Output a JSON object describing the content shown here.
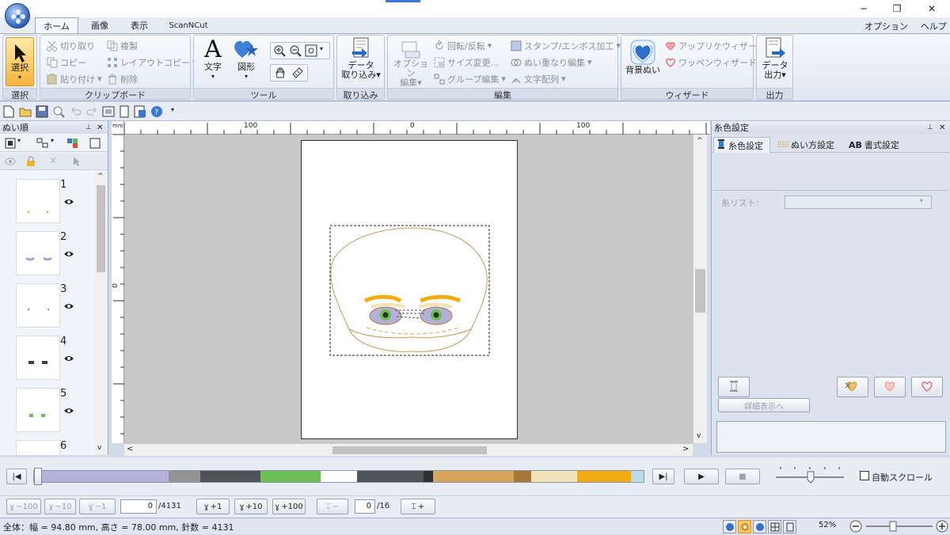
{
  "window": {
    "minimize": "─",
    "maximize": "❐",
    "close": "✕"
  },
  "tabs": [
    "ホーム",
    "画像",
    "表示",
    "ScanNCut"
  ],
  "menu_right": {
    "options": "オプション",
    "help": "ヘルプ"
  },
  "ribbon": {
    "select": {
      "label": "選択",
      "group": "選択"
    },
    "clipboard": {
      "group": "クリップボード",
      "cut": "切り取り",
      "copy": "コピー",
      "paste": "貼り付け",
      "duplicate": "複製",
      "layout_copy": "レイアウトコピー",
      "delete": "削除"
    },
    "tools": {
      "group": "ツール",
      "text": "文字",
      "shape": "図形"
    },
    "import": {
      "group": "取り込み",
      "label_line1": "データ",
      "label_line2": "取り込み"
    },
    "edit": {
      "group": "編集",
      "option_edit_1": "オプション",
      "option_edit_2": "編集",
      "rotate": "回転/反転",
      "resize": "サイズ変更...",
      "group_edit": "グループ編集",
      "stamp": "スタンプ/エンボス加工",
      "overlap": "ぬい重なり編集",
      "text_arrange": "文字配列"
    },
    "wizard": {
      "group": "ウィザード",
      "bg_stitch": "背景ぬい",
      "applique": "アップリケウィザード",
      "patch": "ワッペンウィザード"
    },
    "output": {
      "group": "出力",
      "label_line1": "データ",
      "label_line2": "出力"
    }
  },
  "left_panel": {
    "title": "ぬい順",
    "items": [
      "1",
      "2",
      "3",
      "4",
      "5",
      "6"
    ]
  },
  "ruler": {
    "ticks_top": [
      "100",
      "0",
      "100"
    ],
    "tick_left": "0"
  },
  "right_panel": {
    "title": "糸色設定",
    "tabs": [
      "糸色設定",
      "ぬい方設定",
      "書式設定"
    ],
    "tab3_prefix": "AB",
    "thread_list_label": "糸リスト:",
    "details_button": "詳細表示へ"
  },
  "stitch_bar": {
    "colors": [
      "#b3b1d9",
      "#939393",
      "#4d5358",
      "#6ac050",
      "#ffffff",
      "#4f5459",
      "#2c2e31",
      "#d6a45a",
      "#a67737",
      "#f2e4b6",
      "#f0ac12",
      "#b6dde9"
    ],
    "auto_scroll": "自動スクロール"
  },
  "nav": {
    "minus100": "−100",
    "minus10": "−10",
    "minus1": "−1",
    "stitch_value": "0",
    "stitch_total": "/4131",
    "plus1": "+1",
    "plus10": "+10",
    "plus100": "+100",
    "color_minus": "−",
    "color_value": "0",
    "color_total": "/16",
    "color_plus": "+"
  },
  "status": {
    "text": "全体：幅 = 94.80 mm, 高さ = 78.00 mm, 針数 = 4131",
    "zoom": "52%"
  }
}
